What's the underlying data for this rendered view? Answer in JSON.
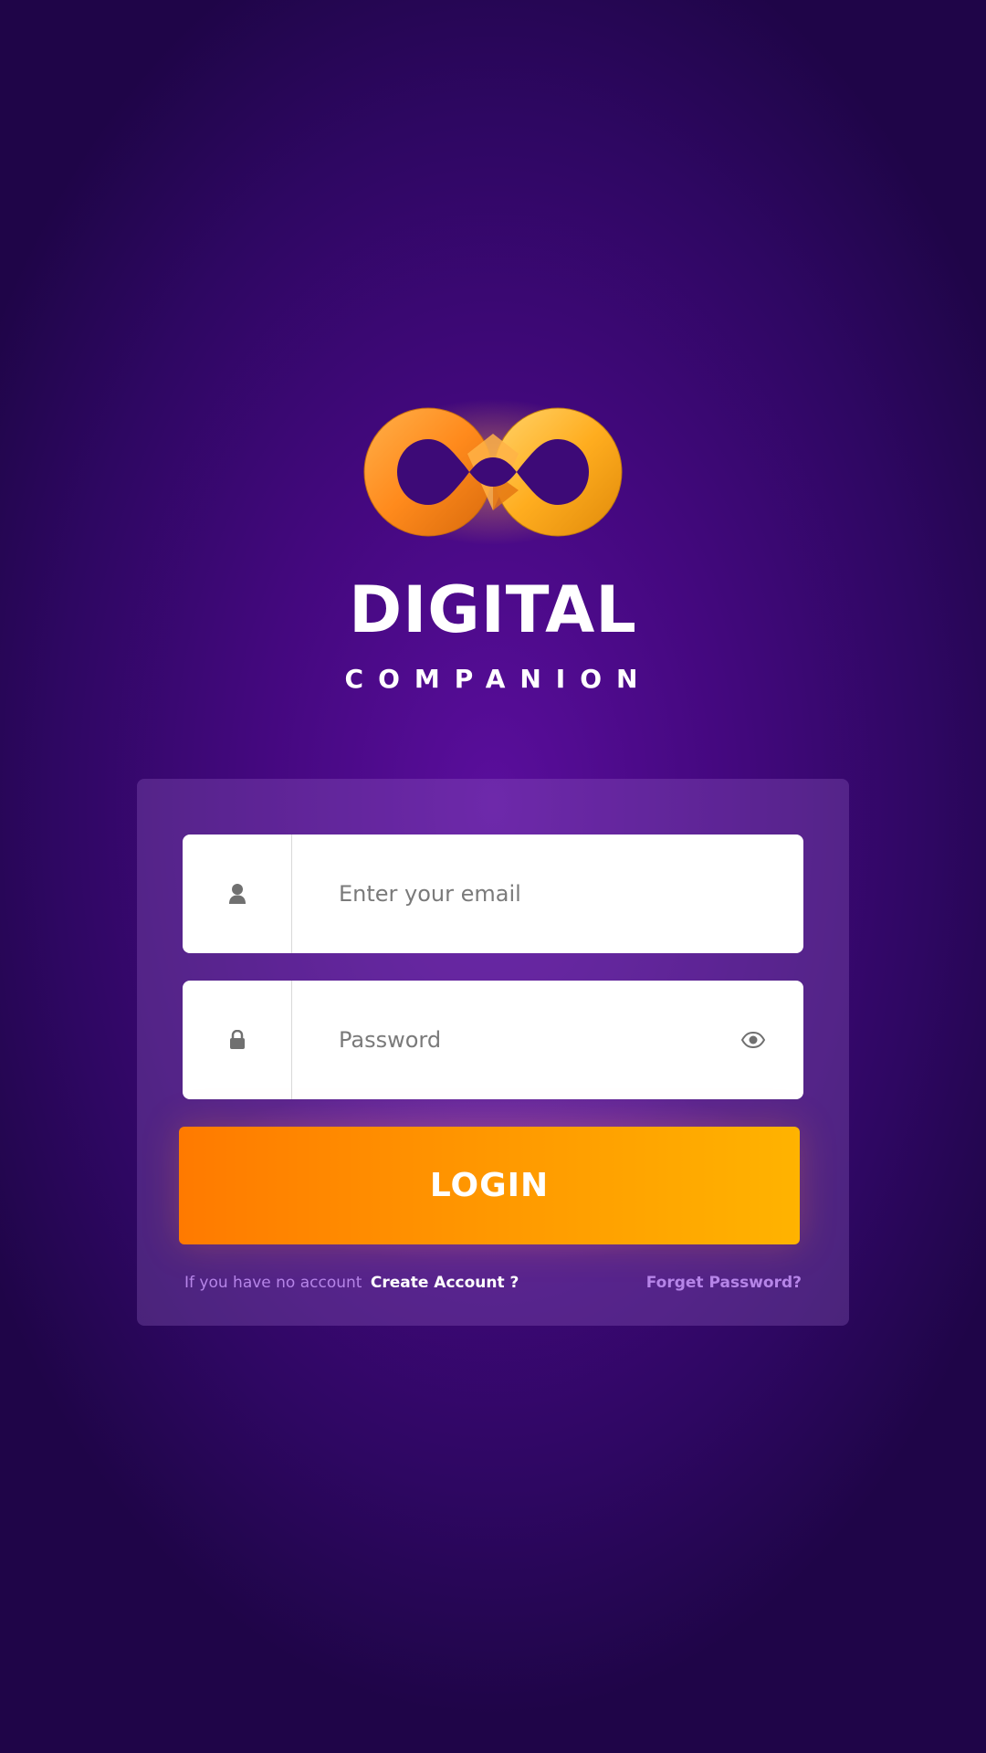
{
  "brand": {
    "title": "DIGITAL",
    "subtitle": "COMPANION",
    "logo_icon": "infinity-logo-icon"
  },
  "login_form": {
    "email": {
      "icon": "user-icon",
      "placeholder": "Enter your email",
      "value": ""
    },
    "password": {
      "icon": "lock-icon",
      "placeholder": "Password",
      "value": "",
      "toggle_icon": "eye-icon"
    },
    "login_label": "LOGIN",
    "no_account_text": "If you have no account",
    "create_account_label": "Create Account ?",
    "forget_password_label": "Forget Password?"
  },
  "colors": {
    "background": "#44087f",
    "accent_start": "#ff7a00",
    "accent_end": "#ffb300",
    "link_muted": "#b685e8"
  }
}
